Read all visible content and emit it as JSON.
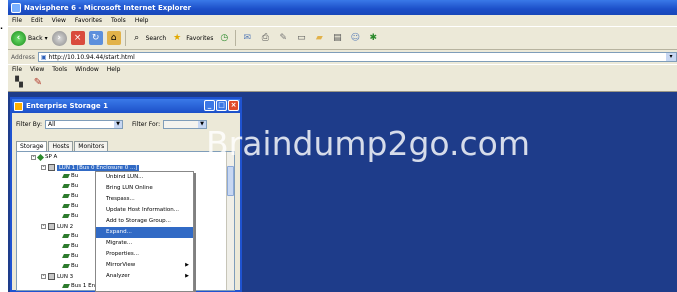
{
  "bullet": "·",
  "browser": {
    "title": "Navisphere 6 - Microsoft Internet Explorer",
    "menu": [
      "File",
      "Edit",
      "View",
      "Favorites",
      "Tools",
      "Help"
    ],
    "toolbar": {
      "back": "Back",
      "search": "Search",
      "favorites": "Favorites"
    },
    "address": {
      "label": "Address",
      "url": "http://10.10.94.44/start.html",
      "go": "▾"
    }
  },
  "app": {
    "menu": [
      "File",
      "View",
      "Tools",
      "Window",
      "Help"
    ]
  },
  "window": {
    "title": "Enterprise Storage 1",
    "filter_by_label": "Filter By:",
    "filter_by_value": "All",
    "filter_for_label": "Filter For:",
    "tabs": [
      "Storage",
      "Hosts",
      "Monitors"
    ],
    "tree": {
      "sp": "SP A",
      "lun1": "LUN 1 [Bus 0 Enclosure 0 ...]",
      "disk_label": "Bu",
      "lun2": "LUN 2",
      "lun3": "LUN 3",
      "last": "Bus 1 Enclosure 0 Disk 2"
    }
  },
  "context_menu": {
    "items": [
      {
        "label": "Unbind LUN..."
      },
      {
        "label": "Bring LUN Online"
      },
      {
        "label": "Trespass..."
      },
      {
        "label": "Update Host Information..."
      },
      {
        "label": "Add to Storage Group..."
      },
      {
        "label": "Expand..."
      },
      {
        "label": "Migrate..."
      },
      {
        "label": "Properties..."
      },
      {
        "label": "MirrorView"
      },
      {
        "label": "Analyzer"
      }
    ]
  },
  "watermark": "Braindump2go.com",
  "colors": {
    "desktop": "#1e3c8a",
    "titlebar": "#1c4fc8",
    "selection": "#316ac5"
  }
}
